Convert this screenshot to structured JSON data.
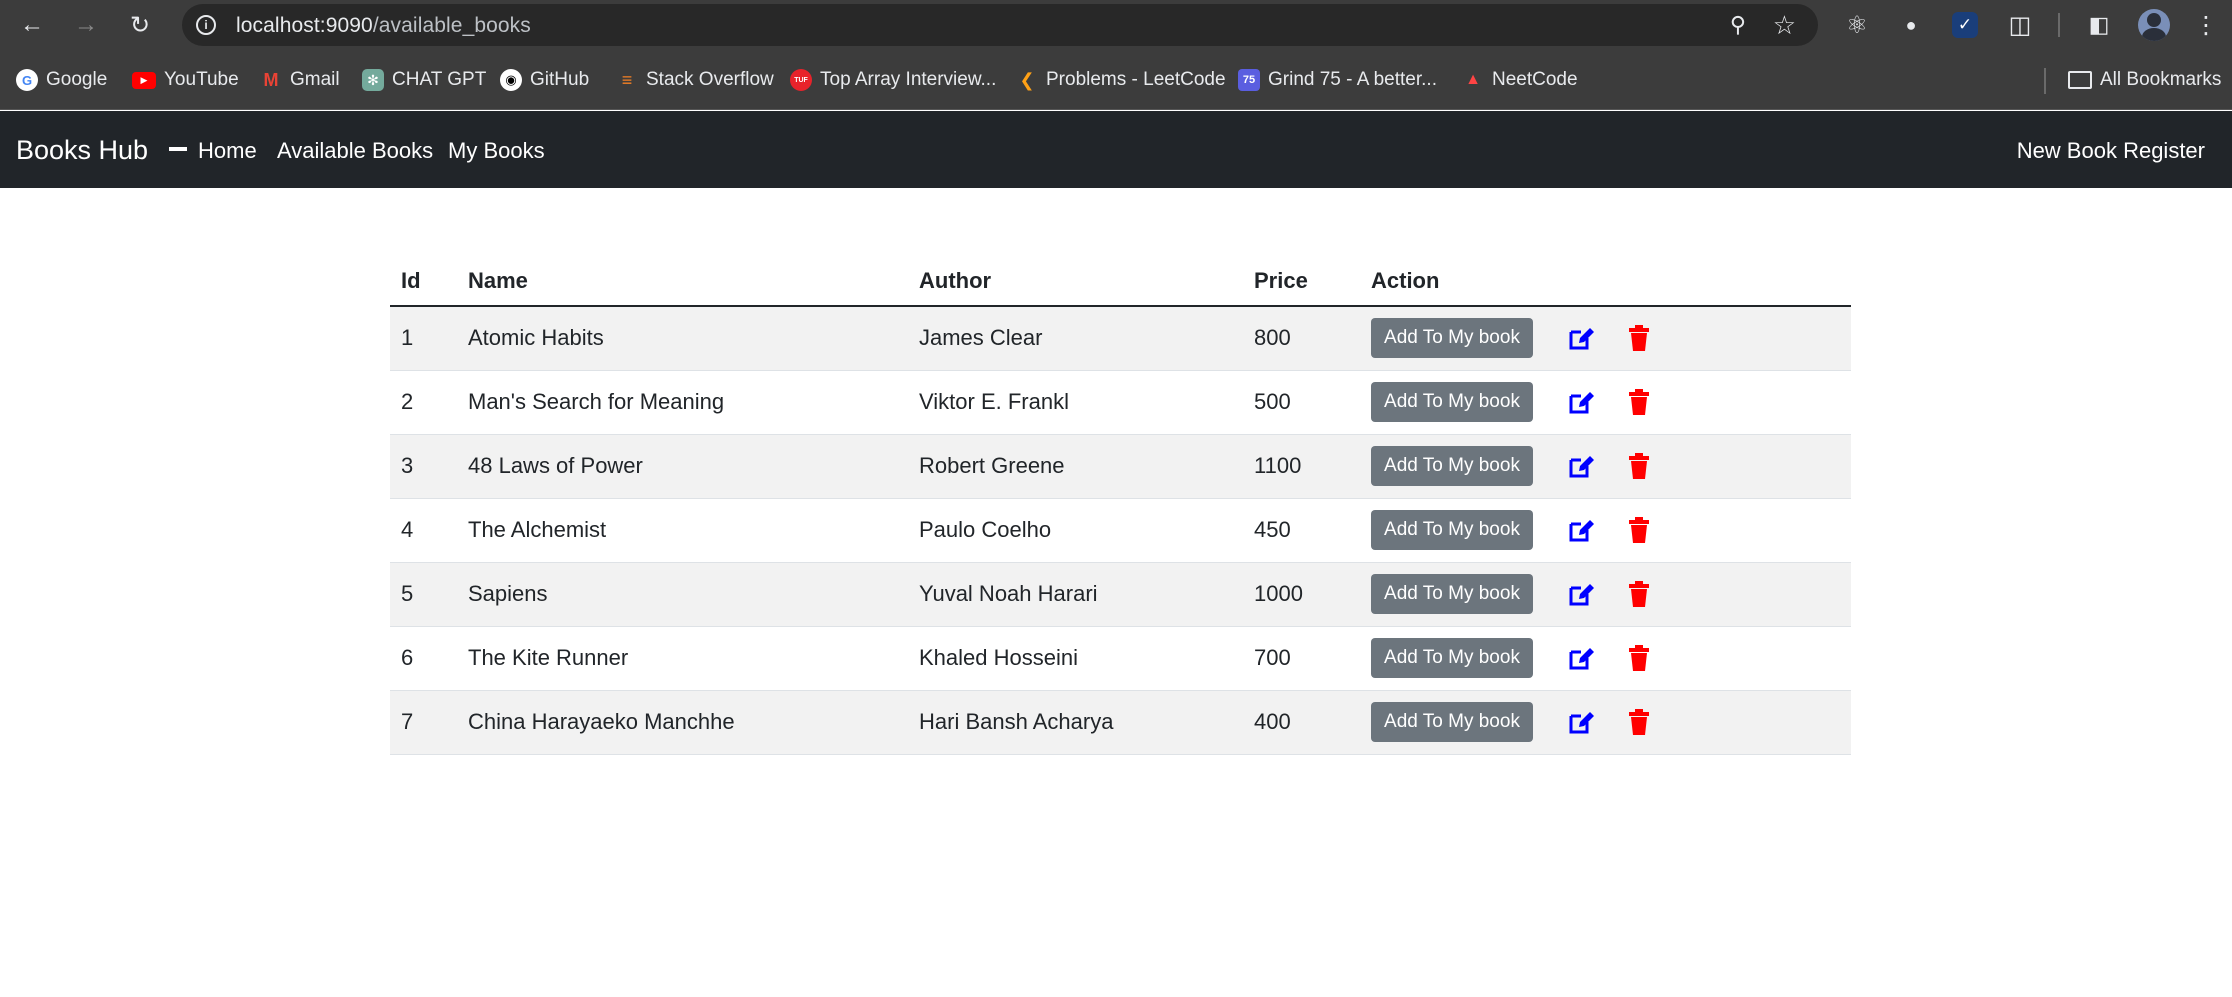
{
  "browser": {
    "url_host": "localhost:9090",
    "url_path": "/available_books",
    "bookmarks": [
      {
        "label": "Google",
        "icon": "google-icon",
        "color": "#4285f4"
      },
      {
        "label": "YouTube",
        "icon": "youtube-icon",
        "color": "#ff0000"
      },
      {
        "label": "Gmail",
        "icon": "gmail-icon",
        "color": "#ea4335"
      },
      {
        "label": "CHAT GPT",
        "icon": "chatgpt-icon",
        "color": "#74aa9c"
      },
      {
        "label": "GitHub",
        "icon": "github-icon",
        "color": "#ffffff"
      },
      {
        "label": "Stack Overflow",
        "icon": "stackoverflow-icon",
        "color": "#f48024"
      },
      {
        "label": "Top Array Interview...",
        "icon": "tuf-icon",
        "color": "#e8232b"
      },
      {
        "label": "Problems - LeetCode",
        "icon": "leetcode-icon",
        "color": "#ffa116"
      },
      {
        "label": "Grind 75 - A better...",
        "icon": "grind75-icon",
        "color": "#5a5ee0"
      },
      {
        "label": "NeetCode",
        "icon": "neetcode-icon",
        "color": "#ff4444"
      }
    ],
    "all_bookmarks": "All Bookmarks",
    "grind_badge": "75",
    "tuf_badge": "TUF"
  },
  "navbar": {
    "brand": "Books Hub",
    "links": [
      "Home",
      "Available Books",
      "My Books"
    ],
    "register": "New Book Register"
  },
  "table": {
    "headers": [
      "Id",
      "Name",
      "Author",
      "Price",
      "Action"
    ],
    "add_label": "Add To My book",
    "rows": [
      {
        "id": "1",
        "name": "Atomic Habits",
        "author": "James Clear",
        "price": "800"
      },
      {
        "id": "2",
        "name": "Man's Search for Meaning",
        "author": "Viktor E. Frankl",
        "price": "500"
      },
      {
        "id": "3",
        "name": "48 Laws of Power",
        "author": "Robert Greene",
        "price": "1100"
      },
      {
        "id": "4",
        "name": "The Alchemist",
        "author": "Paulo Coelho",
        "price": "450"
      },
      {
        "id": "5",
        "name": "Sapiens",
        "author": "Yuval Noah Harari",
        "price": "1000"
      },
      {
        "id": "6",
        "name": "The Kite Runner",
        "author": "Khaled Hosseini",
        "price": "700"
      },
      {
        "id": "7",
        "name": "China Harayaeko Manchhe",
        "author": "Hari Bansh Acharya",
        "price": "400"
      }
    ]
  },
  "colors": {
    "edit_icon": "#0000ff",
    "delete_icon": "#ff0000",
    "navbar_bg": "#212529",
    "add_button_bg": "#6c757d"
  }
}
